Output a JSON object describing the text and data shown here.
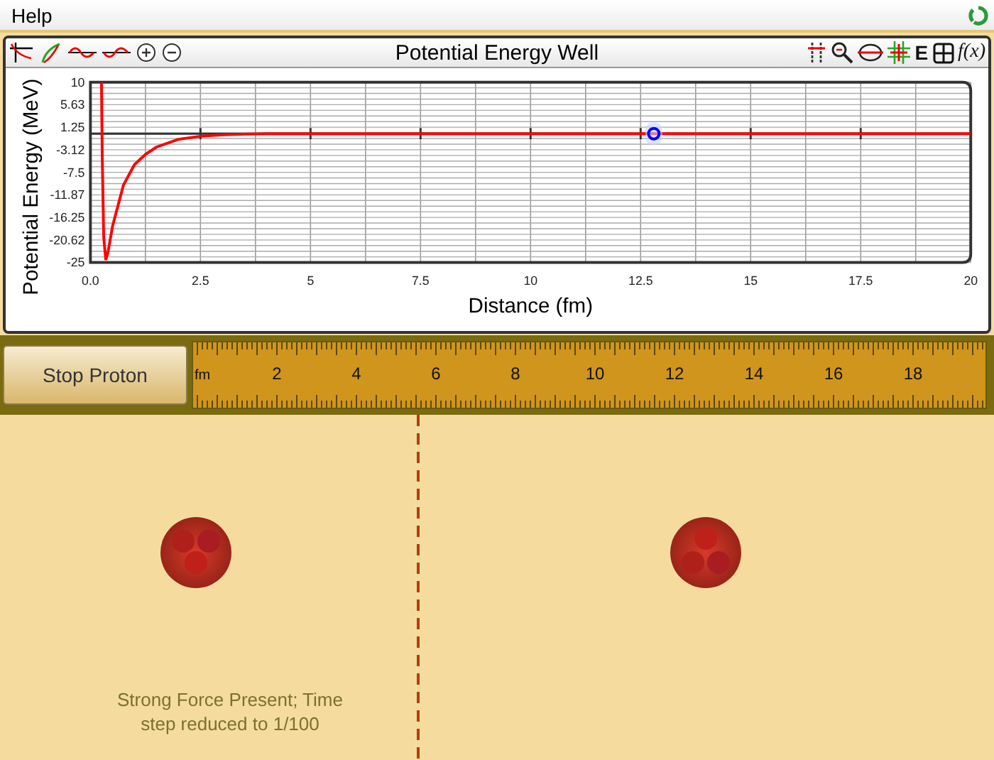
{
  "menu": {
    "items": [
      "Help"
    ]
  },
  "panel": {
    "title": "Potential Energy Well",
    "energy_button": "E",
    "function_button": "f(x)",
    "chart_data": {
      "type": "line",
      "xlabel": "Distance (fm)",
      "ylabel": "Potential Energy (MeV)",
      "x": [
        0.25,
        0.27,
        0.3,
        0.35,
        0.4,
        0.5,
        0.75,
        1,
        1.25,
        1.5,
        2,
        2.5,
        3,
        3.5,
        4,
        5,
        7.5,
        10,
        12.5,
        15,
        17.5,
        20
      ],
      "series": [
        {
          "color": "#ff0000",
          "values": [
            10,
            -5,
            -20,
            -24.5,
            -23,
            -18,
            -10,
            -6,
            -4,
            -2.6,
            -1.1,
            -0.5,
            -0.2,
            -0.1,
            0,
            0,
            0,
            0,
            0,
            0,
            0,
            0
          ]
        }
      ],
      "xlim": [
        0,
        20
      ],
      "ylim": [
        -25,
        10
      ],
      "xticks": [
        {
          "value": 0,
          "label": "0.0"
        },
        2.5,
        5,
        7.5,
        10,
        12.5,
        15,
        17.5,
        20
      ],
      "yticks": [
        10,
        {
          "value": 5.625,
          "label": "5.63"
        },
        1.25,
        {
          "value": -3.125,
          "label": "-3.12"
        },
        -7.5,
        {
          "value": -11.875,
          "label": "-11.87"
        },
        -16.25,
        {
          "value": -20.625,
          "label": "-20.62"
        },
        -25
      ],
      "grid": true
    }
  },
  "controls": {
    "stop_button": "Stop Proton"
  },
  "ruler": {
    "unit": "fm",
    "labels": [
      "2",
      "4",
      "6",
      "8",
      "10",
      "12",
      "14",
      "16",
      "18"
    ]
  },
  "status_message": "Strong Force Present; Time step reduced to 1/100"
}
